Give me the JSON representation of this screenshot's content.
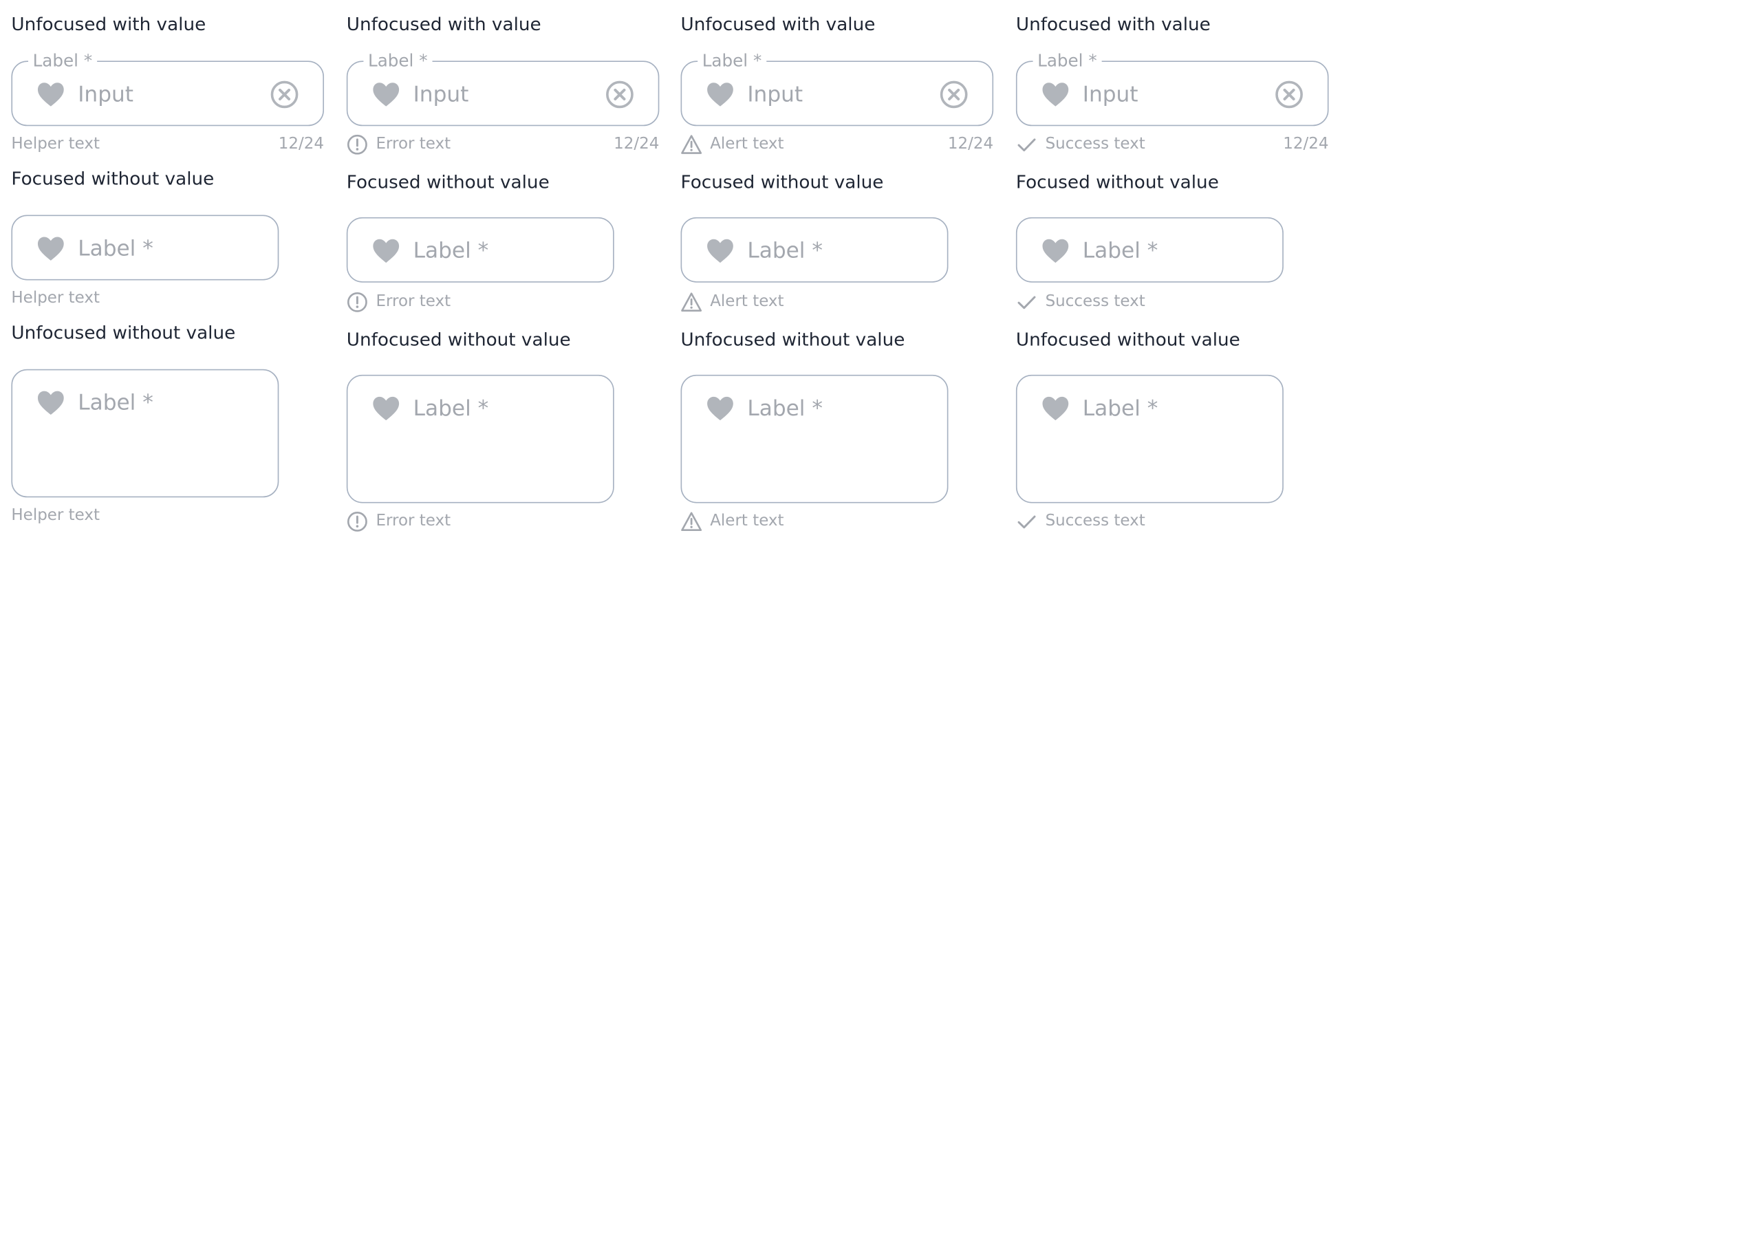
{
  "colors": {
    "title": "#1e2533",
    "border": "#a6b1c1",
    "muted_text": "#a3a7ae",
    "icon": "#b1b5bb"
  },
  "columns": [
    {
      "variant": "helper",
      "status_icon": null,
      "rows": [
        {
          "title": "Unfocused with value",
          "legend": "Label *",
          "value": "Input",
          "helper": "Helper text",
          "counter": "12/24"
        },
        {
          "title": "Focused without value",
          "placeholder": "Label *",
          "helper": "Helper text"
        },
        {
          "title": "Unfocused without value",
          "placeholder": "Label *",
          "helper": "Helper text"
        }
      ]
    },
    {
      "variant": "error",
      "status_icon": "error-circle-icon",
      "rows": [
        {
          "title": "Unfocused with value",
          "legend": "Label *",
          "value": "Input",
          "helper": "Error text",
          "counter": "12/24"
        },
        {
          "title": "Focused without value",
          "placeholder": "Label *",
          "helper": "Error text"
        },
        {
          "title": "Unfocused without value",
          "placeholder": "Label *",
          "helper": "Error text"
        }
      ]
    },
    {
      "variant": "alert",
      "status_icon": "alert-triangle-icon",
      "rows": [
        {
          "title": "Unfocused with value",
          "legend": "Label *",
          "value": "Input",
          "helper": "Alert text",
          "counter": "12/24"
        },
        {
          "title": "Focused without value",
          "placeholder": "Label *",
          "helper": "Alert text"
        },
        {
          "title": "Unfocused without value",
          "placeholder": "Label *",
          "helper": "Alert text"
        }
      ]
    },
    {
      "variant": "success",
      "status_icon": "check-icon",
      "rows": [
        {
          "title": "Unfocused with value",
          "legend": "Label *",
          "value": "Input",
          "helper": "Success text",
          "counter": "12/24"
        },
        {
          "title": "Focused without value",
          "placeholder": "Label *",
          "helper": "Success text"
        },
        {
          "title": "Unfocused without value",
          "placeholder": "Label *",
          "helper": "Success text"
        }
      ]
    }
  ]
}
